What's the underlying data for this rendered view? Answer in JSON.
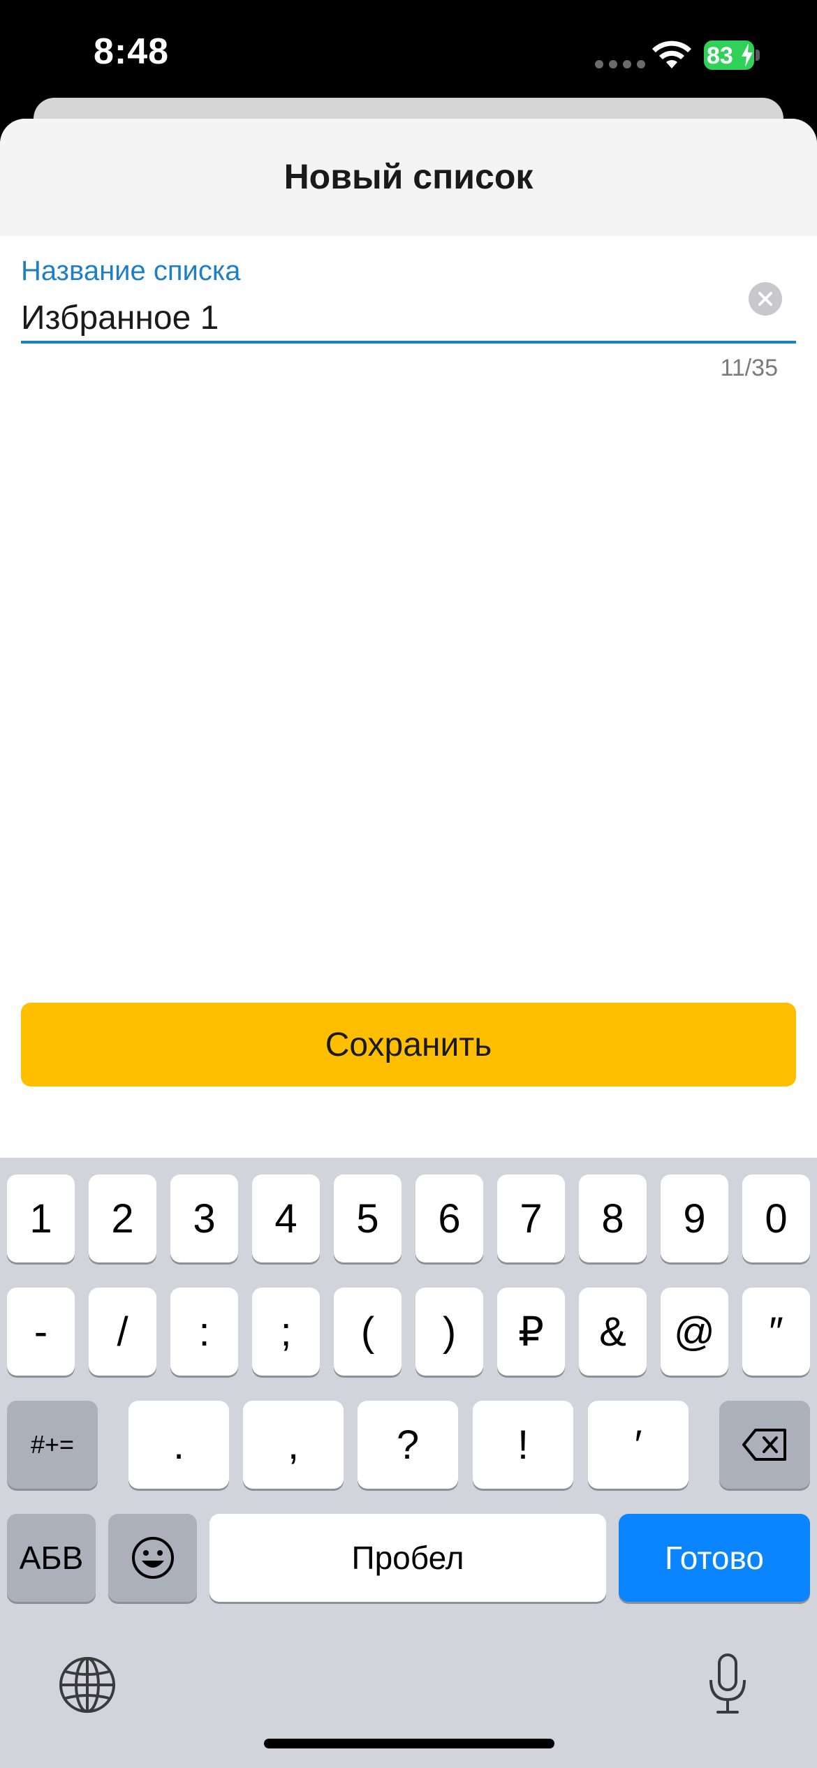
{
  "status_bar": {
    "time": "8:48",
    "battery": "83"
  },
  "sheet": {
    "title": "Новый список"
  },
  "list_name_field": {
    "label": "Название списка",
    "value": "Избранное 1",
    "counter": "11/35"
  },
  "save_button": {
    "label": "Сохранить"
  },
  "keyboard": {
    "row1": [
      "1",
      "2",
      "3",
      "4",
      "5",
      "6",
      "7",
      "8",
      "9",
      "0"
    ],
    "row2": [
      "-",
      "/",
      ":",
      ";",
      "(",
      ")",
      "₽",
      "&",
      "@",
      "″"
    ],
    "row3": [
      ".",
      ",",
      "?",
      "!",
      "′"
    ],
    "symbols_toggle": "#+=",
    "letters_toggle": "АБВ",
    "space": "Пробел",
    "done": "Готово"
  },
  "colors": {
    "accent": "#1f7fc3",
    "save": "#ffbf00",
    "done_key": "#0a84ff"
  }
}
